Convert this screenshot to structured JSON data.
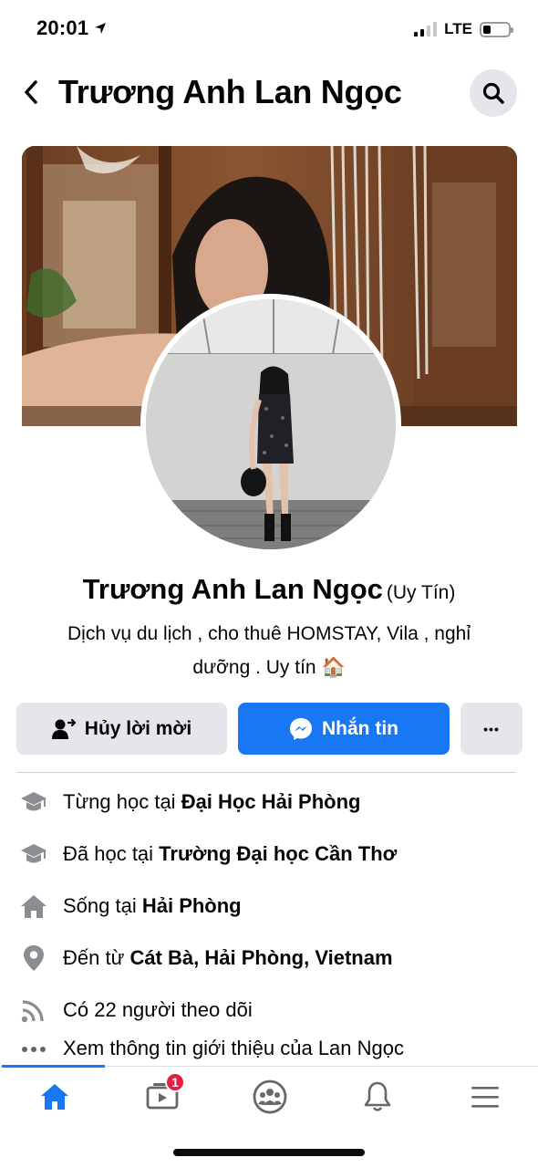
{
  "status_bar": {
    "time": "20:01",
    "network": "LTE",
    "signal_bars": 2,
    "battery_level": 0.3
  },
  "header": {
    "title": "Trương Anh Lan Ngọc",
    "back_icon": "chevron-left-icon",
    "search_icon": "search-icon"
  },
  "profile": {
    "name": "Trương Anh Lan Ngọc",
    "name_suffix": "(Uy Tín)",
    "bio_line1": "Dịch vụ du lịch , cho thuê HOMSTAY, Vila , nghỉ",
    "bio_line2": "dưỡng . Uy tín 🏠"
  },
  "actions": {
    "cancel_request": "Hủy lời mời",
    "message": "Nhắn tin",
    "more": "•••"
  },
  "info": [
    {
      "icon": "graduation-cap-icon",
      "prefix": "Từng học tại ",
      "value": "Đại Học Hải Phòng"
    },
    {
      "icon": "graduation-cap-icon",
      "prefix": "Đã học tại ",
      "value": "Trường Đại học Cần Thơ"
    },
    {
      "icon": "house-icon",
      "prefix": "Sống tại ",
      "value": "Hải Phòng"
    },
    {
      "icon": "location-pin-icon",
      "prefix": "Đến từ ",
      "value": "Cát Bà, Hải Phòng, Vietnam"
    },
    {
      "icon": "followers-rss-icon",
      "prefix": "Có 22 người theo dõi",
      "value": ""
    },
    {
      "icon": "more-dots-icon",
      "prefix": "Xem thông tin giới thiệu của Lan Ngọc",
      "value": ""
    }
  ],
  "bottom_nav": {
    "items": [
      "home-icon",
      "watch-icon",
      "groups-icon",
      "notifications-bell-icon",
      "menu-icon"
    ],
    "watch_badge": "1",
    "active": "home-icon"
  },
  "colors": {
    "accent": "#1877f2",
    "button_gray": "#e4e6eb",
    "badge_red": "#e41e3f"
  }
}
